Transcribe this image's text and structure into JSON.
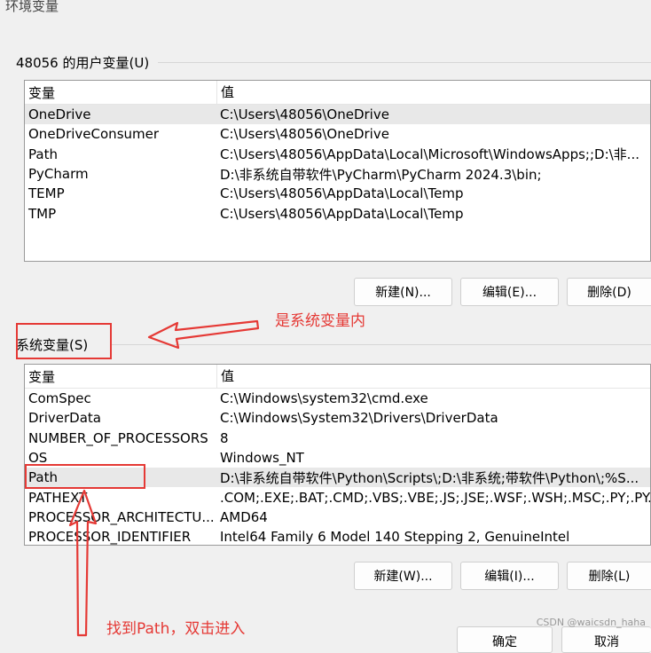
{
  "window": {
    "title": "环境变量"
  },
  "user_vars": {
    "group_label": "48056 的用户变量(U)",
    "header": {
      "name": "变量",
      "value": "值"
    },
    "rows": [
      {
        "name": "OneDrive",
        "value": "C:\\Users\\48056\\OneDrive"
      },
      {
        "name": "OneDriveConsumer",
        "value": "C:\\Users\\48056\\OneDrive"
      },
      {
        "name": "Path",
        "value": "C:\\Users\\48056\\AppData\\Local\\Microsoft\\WindowsApps;;D:\\非..."
      },
      {
        "name": "PyCharm",
        "value": "D:\\非系统自带软件\\PyCharm\\PyCharm 2024.3\\bin;"
      },
      {
        "name": "TEMP",
        "value": "C:\\Users\\48056\\AppData\\Local\\Temp"
      },
      {
        "name": "TMP",
        "value": "C:\\Users\\48056\\AppData\\Local\\Temp"
      }
    ],
    "buttons": {
      "new": "新建(N)...",
      "edit": "编辑(E)...",
      "delete": "删除(D)"
    }
  },
  "system_vars": {
    "group_label": "系统变量(S)",
    "header": {
      "name": "变量",
      "value": "值"
    },
    "rows": [
      {
        "name": "ComSpec",
        "value": "C:\\Windows\\system32\\cmd.exe"
      },
      {
        "name": "DriverData",
        "value": "C:\\Windows\\System32\\Drivers\\DriverData"
      },
      {
        "name": "NUMBER_OF_PROCESSORS",
        "value": "8"
      },
      {
        "name": "OS",
        "value": "Windows_NT"
      },
      {
        "name": "Path",
        "value": "D:\\非系统自带软件\\Python\\Scripts\\;D:\\非系统;带软件\\Python\\;%S..."
      },
      {
        "name": "PATHEXT",
        "value": ".COM;.EXE;.BAT;.CMD;.VBS;.VBE;.JS;.JSE;.WSF;.WSH;.MSC;.PY;.PY..."
      },
      {
        "name": "PROCESSOR_ARCHITECTU...",
        "value": "AMD64"
      },
      {
        "name": "PROCESSOR_IDENTIFIER",
        "value": "Intel64 Family 6 Model 140 Stepping 2, GenuineIntel"
      }
    ],
    "buttons": {
      "new": "新建(W)...",
      "edit": "编辑(I)...",
      "delete": "删除(L)"
    }
  },
  "annotations": {
    "system_note": "是系统变量内",
    "path_note": "找到Path，双击进入",
    "color": "#e53935"
  },
  "bottom_buttons": {
    "ok": "确定",
    "cancel": "取消"
  },
  "watermark": "CSDN @waicsdn_haha"
}
